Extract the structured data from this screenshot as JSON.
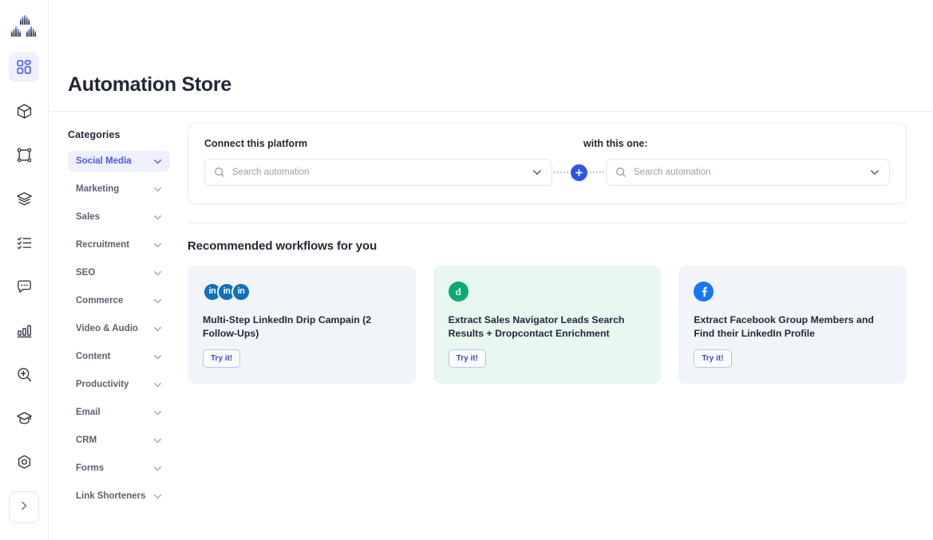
{
  "app": {
    "logo_name": "automation-platform-logo"
  },
  "rail": {
    "items": [
      {
        "icon": "grid-apps-icon",
        "name": "sidebar-item-dashboard",
        "active": true
      },
      {
        "icon": "cube-icon",
        "name": "sidebar-item-packages",
        "active": false
      },
      {
        "icon": "frame-nodes-icon",
        "name": "sidebar-item-workflows",
        "active": false
      },
      {
        "icon": "layers-icon",
        "name": "sidebar-item-layers",
        "active": false
      },
      {
        "icon": "checklist-icon",
        "name": "sidebar-item-tasks",
        "active": false
      },
      {
        "icon": "chat-bubble-icon",
        "name": "sidebar-item-messages",
        "active": false
      },
      {
        "icon": "bar-chart-icon",
        "name": "sidebar-item-analytics",
        "active": false
      },
      {
        "icon": "search-plus-icon",
        "name": "sidebar-item-discover",
        "active": false
      },
      {
        "icon": "graduation-cap-icon",
        "name": "sidebar-item-academy",
        "active": false
      },
      {
        "icon": "hexagon-settings-icon",
        "name": "sidebar-item-settings",
        "active": false
      }
    ],
    "expand_icon": "chevron-right-icon"
  },
  "header": {
    "title": "Automation Store"
  },
  "categories": {
    "title": "Categories",
    "items": [
      {
        "label": "Social Media",
        "active": true
      },
      {
        "label": "Marketing",
        "active": false
      },
      {
        "label": "Sales",
        "active": false
      },
      {
        "label": "Recruitment",
        "active": false
      },
      {
        "label": "SEO",
        "active": false
      },
      {
        "label": "Commerce",
        "active": false
      },
      {
        "label": "Video & Audio",
        "active": false
      },
      {
        "label": "Content",
        "active": false
      },
      {
        "label": "Productivity",
        "active": false
      },
      {
        "label": "Email",
        "active": false
      },
      {
        "label": "CRM",
        "active": false
      },
      {
        "label": "Forms",
        "active": false
      },
      {
        "label": "Link Shorteners",
        "active": false
      }
    ]
  },
  "connect": {
    "left_label": "Connect this platform",
    "right_label": "with this one:",
    "left_placeholder": "Search automation",
    "right_placeholder": "Search automation",
    "left_value": "",
    "right_value": "",
    "plus_label": "+",
    "accent": "#2f55e8"
  },
  "recommended": {
    "title": "Recommended workflows for you",
    "cards": [
      {
        "name": "Multi-Step LinkedIn Drip Campain (2 Follow-Ups)",
        "cta": "Try it!",
        "bg": "#f1f5fa",
        "icon_kind": "linkedin-stack",
        "icon_count": 3,
        "icon_label": "in"
      },
      {
        "name": "Extract Sales Navigator Leads Search Results + Dropcontact Enrichment",
        "cta": "Try it!",
        "bg": "#e8f7f0",
        "icon_kind": "dropcontact",
        "icon_count": 1,
        "icon_label": "d"
      },
      {
        "name": "Extract Facebook Group Members and Find their LinkedIn Profile",
        "cta": "Try it!",
        "bg": "#f1f5fa",
        "icon_kind": "facebook",
        "icon_count": 1,
        "icon_label": "f"
      }
    ]
  }
}
